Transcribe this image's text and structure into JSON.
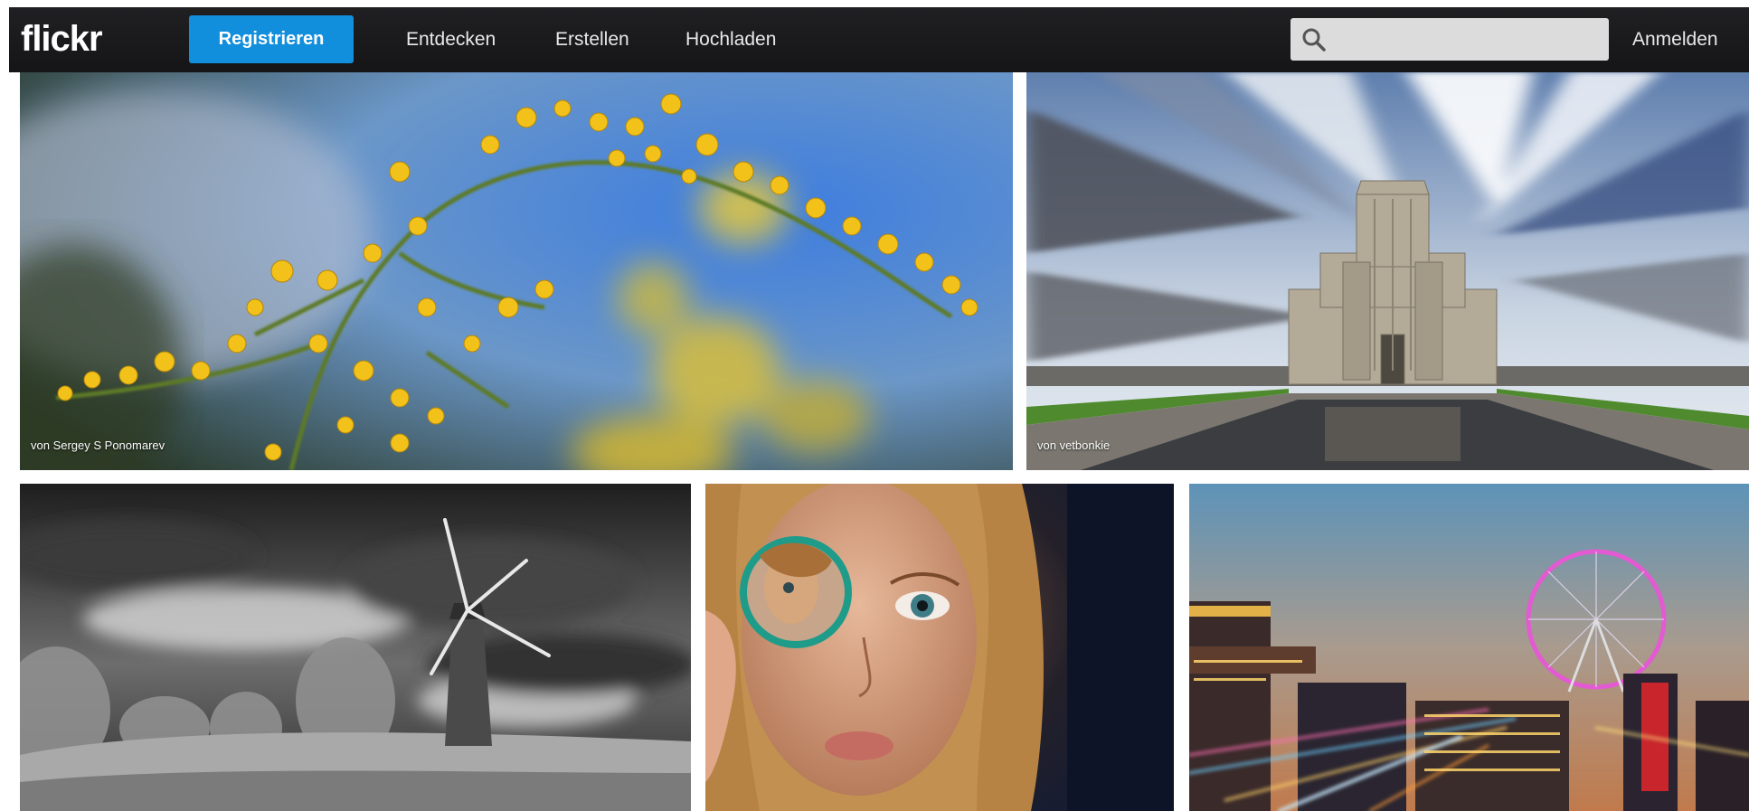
{
  "header": {
    "logo": "flickr",
    "register_label": "Registrieren",
    "nav": [
      {
        "label": "Entdecken"
      },
      {
        "label": "Erstellen"
      },
      {
        "label": "Hochladen"
      }
    ],
    "search": {
      "placeholder": "",
      "value": "",
      "icon": "search-icon"
    },
    "login_label": "Anmelden"
  },
  "colors": {
    "topbar": "#1c1c1e",
    "register_button": "#128fdc"
  },
  "photos": [
    {
      "subject": "yellow-flower",
      "credit": "von Sergey S Ponomarev"
    },
    {
      "subject": "art-deco-building",
      "credit": "von vetbonkie"
    },
    {
      "subject": "windmill",
      "credit": ""
    },
    {
      "subject": "girl-magnifier",
      "credit": ""
    },
    {
      "subject": "city-ferris-wheel",
      "credit": ""
    }
  ]
}
